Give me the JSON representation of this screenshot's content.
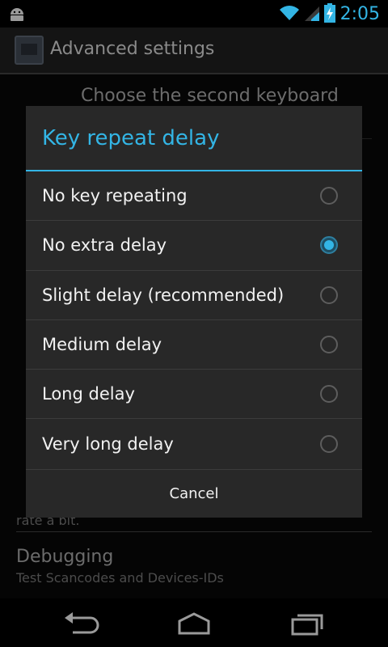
{
  "status_bar": {
    "time": "2:05",
    "icons": [
      "android-notification-icon",
      "wifi-icon",
      "signal-icon",
      "battery-charging-icon"
    ],
    "accent_color": "#33b5e5"
  },
  "action_bar": {
    "title": "Advanced settings",
    "icon": "app-icon"
  },
  "background_list": {
    "items": [
      {
        "title": "Choose the second keyboard lay...",
        "subtitle": ""
      },
      {
        "title": "",
        "subtitle": "rate a bit."
      },
      {
        "title": "Debugging",
        "subtitle": "Test Scancodes and Devices-IDs"
      }
    ]
  },
  "dialog": {
    "title": "Key repeat delay",
    "options": [
      {
        "label": "No key repeating",
        "checked": false
      },
      {
        "label": "No extra delay",
        "checked": true
      },
      {
        "label": "Slight delay (recommended)",
        "checked": false
      },
      {
        "label": "Medium delay",
        "checked": false
      },
      {
        "label": "Long delay",
        "checked": false
      },
      {
        "label": "Very long delay",
        "checked": false
      }
    ],
    "cancel_label": "Cancel"
  },
  "nav_bar": {
    "buttons": [
      "back-icon",
      "home-icon",
      "recent-apps-icon"
    ]
  },
  "colors": {
    "accent": "#33b5e5",
    "dialog_bg": "#282828",
    "divider": "#3c3c3c"
  }
}
